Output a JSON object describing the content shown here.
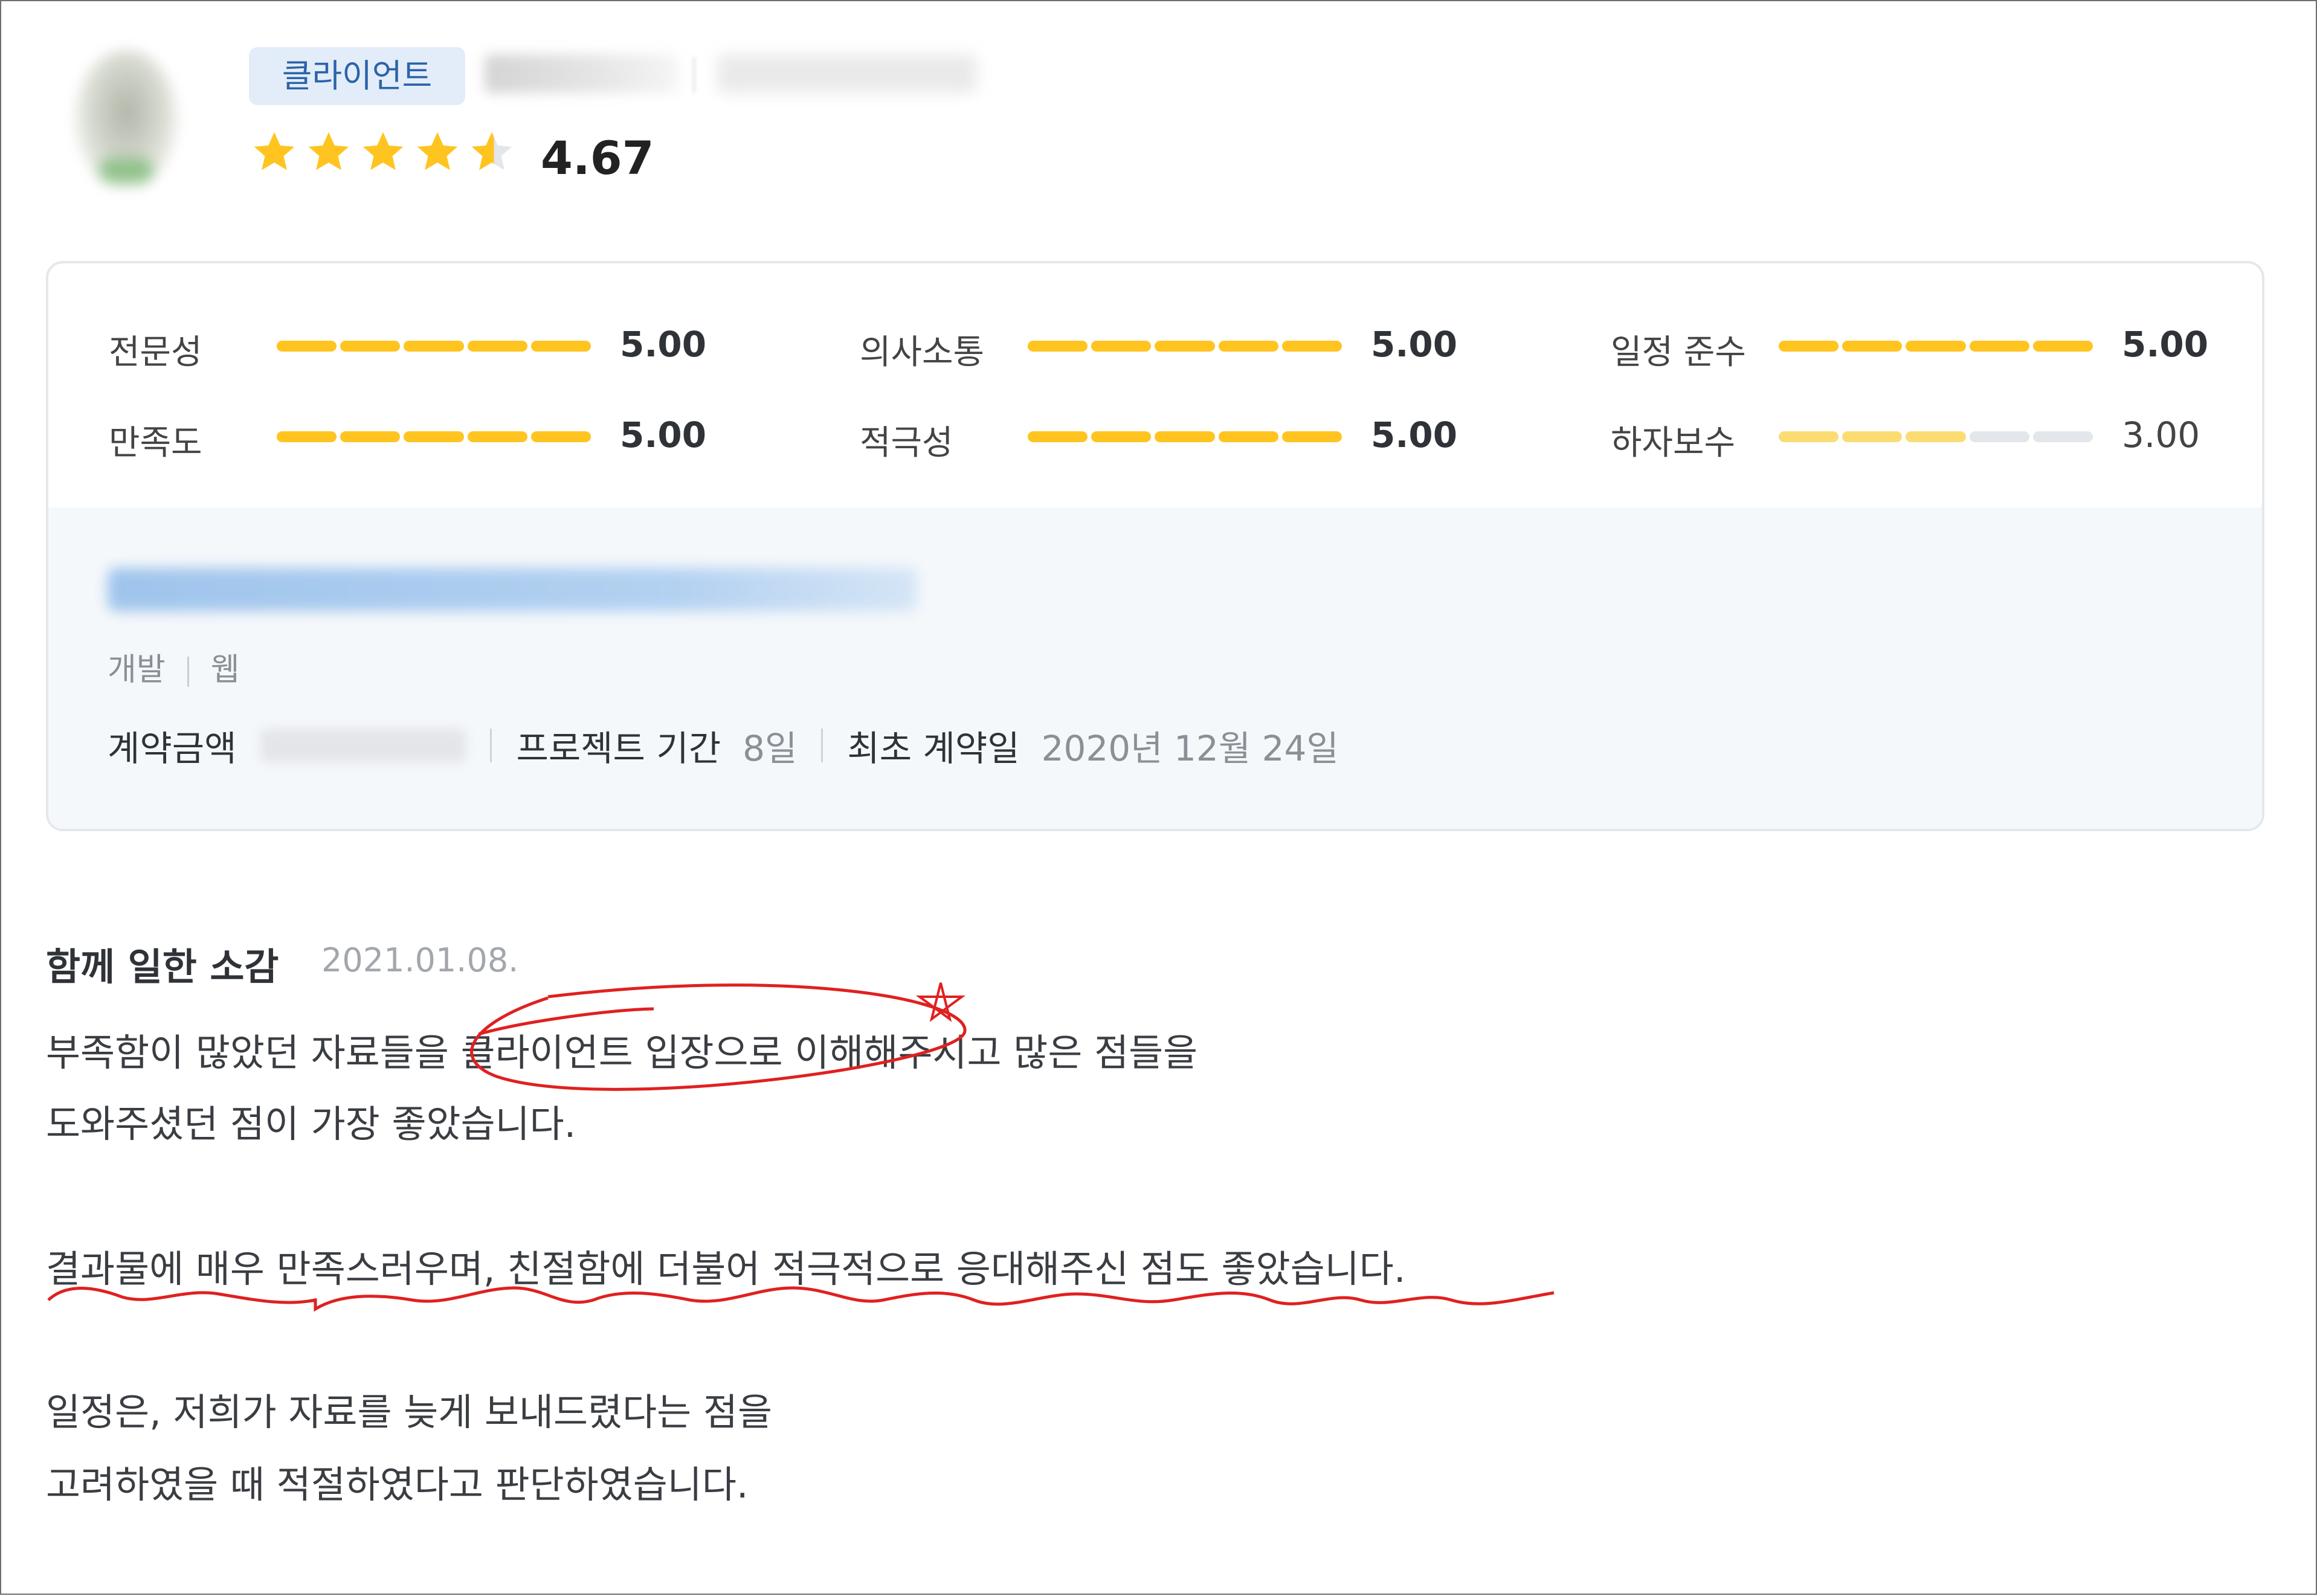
{
  "profile": {
    "badge": "클라이언트",
    "rating": "4.67",
    "stars": 4.67,
    "star_color": "#ffc41f"
  },
  "metrics": [
    {
      "label": "전문성",
      "value": "5.00",
      "score": 5
    },
    {
      "label": "의사소통",
      "value": "5.00",
      "score": 5
    },
    {
      "label": "일정 준수",
      "value": "5.00",
      "score": 5
    },
    {
      "label": "만족도",
      "value": "5.00",
      "score": 5
    },
    {
      "label": "적극성",
      "value": "5.00",
      "score": 5
    },
    {
      "label": "하자보수",
      "value": "3.00",
      "score": 3
    }
  ],
  "project": {
    "category": "개발",
    "subcategory": "웹",
    "amount_label": "계약금액",
    "period_label": "프로젝트 기간",
    "period_value": "8일",
    "first_contract_label": "최초 계약일",
    "first_contract_value": "2020년 12월 24일"
  },
  "review": {
    "title": "함께 일한 소감",
    "date": "2021.01.08.",
    "lines": [
      "부족함이 많았던 자료들을 클라이언트 입장으로 이해해주시고 많은 점들을",
      "도와주셨던 점이 가장 좋았습니다.",
      "결과물에 매우 만족스러우며, 친절함에 더불어 적극적으로 응대해주신 점도 좋았습니다.",
      "일정은, 저희가 자료를 늦게 보내드렸다는 점을",
      "고려하였을 때 적절하였다고 판단하였습니다."
    ]
  },
  "annotation_color": "#e02020"
}
